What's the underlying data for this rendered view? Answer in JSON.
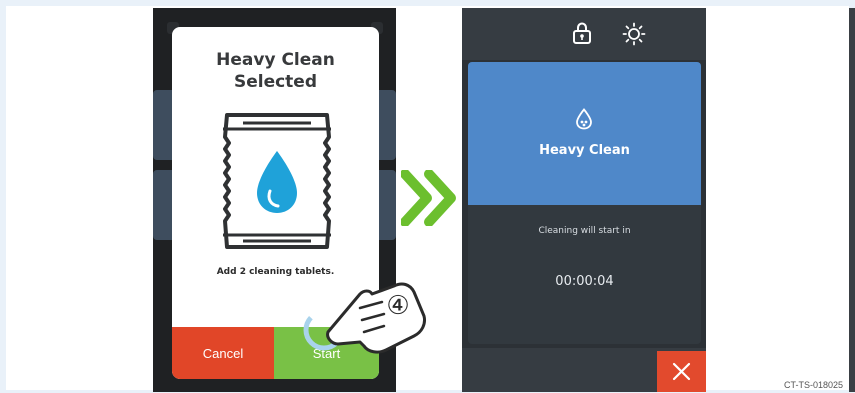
{
  "dialog": {
    "title_line1": "Heavy Clean",
    "title_line2": "Selected",
    "message": "Add 2 cleaning tablets.",
    "cancel_label": "Cancel",
    "start_label": "Start"
  },
  "step_number": "④",
  "status_screen": {
    "program_name": "Heavy Clean",
    "countdown_label": "Cleaning will start in",
    "countdown_value": "00:00:04",
    "icons": [
      "lock-icon",
      "brightness-icon",
      "water-drop-icon",
      "close-icon"
    ]
  },
  "figure_code": "CT-TS-018025",
  "colors": {
    "cancel": "#e14628",
    "start": "#79c146",
    "program_card": "#4f88c9",
    "arrow": "#6cbf2e",
    "close": "#e24a2d"
  }
}
